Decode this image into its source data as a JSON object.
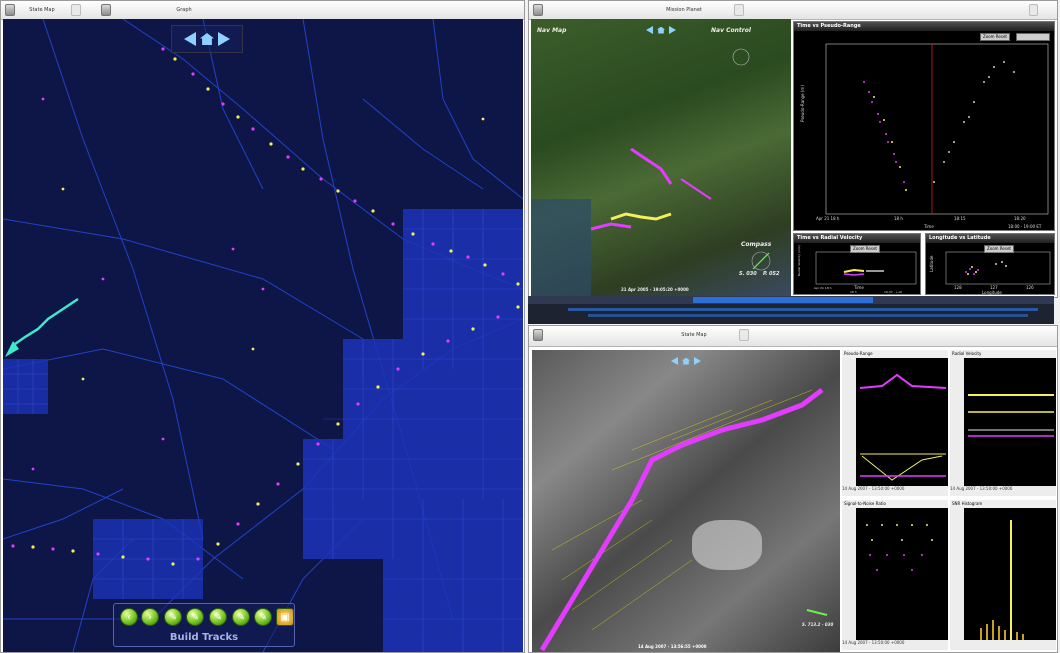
{
  "left_window": {
    "tabs": [
      {
        "label": "State Map"
      },
      {
        "label": "Graph"
      }
    ],
    "toolbar": {
      "label": "Build Tracks",
      "buttons": [
        "back-icon",
        "forward-icon",
        "wrench-icon",
        "pencil-icon",
        "pencil-icon",
        "pencil-icon",
        "pencil-icon",
        "save-icon"
      ]
    },
    "colors": {
      "map_bg": "#0e1648",
      "roads": "#2a4de0",
      "track_magenta": "#e23cff",
      "track_yellow": "#f4ef5a",
      "cyan_track": "#3ee8c8"
    }
  },
  "right_top_window": {
    "tab": "Mission Planet",
    "map_labels": {
      "nav_map": "Nav Map",
      "nav_control": "Nav Control",
      "compass": "Compass"
    },
    "readouts": {
      "timestamp": "21 Apr 2005 - 19:05:20 +0000",
      "left": "S. 030",
      "right": "P. 052"
    },
    "charts": [
      {
        "title": "Time vs Pseudo-Range",
        "zoom_reset": "Zoom Reset",
        "ylabel": "Pseudo-Range (m)",
        "xlabel": "Time",
        "x_ticks": [
          "Apr 21 18 h",
          "18 h",
          "18:15",
          "18:20"
        ],
        "footer": "18:00 - 19:00 ET"
      },
      {
        "title": "Time vs Radial Velocity",
        "zoom_reset": "Zoom Reset",
        "ylabel": "Radial Velocity (m/s)",
        "xlabel": "Time",
        "x_ticks": [
          "Apr 21 18 h",
          "18 h"
        ],
        "footer": "19:37 - +10"
      },
      {
        "title": "Longitude vs Latitude",
        "zoom_reset": "Zoom Reset",
        "ylabel": "Latitude",
        "xlabel": "Longitude",
        "x_ticks": [
          "128",
          "127",
          "126"
        ]
      }
    ]
  },
  "right_bottom_window": {
    "tab": "State Map",
    "timestamp": "14 Aug 2007 - 13:56:55 +0000",
    "readout": "S. 713.2 - 030",
    "panels": [
      {
        "title": "Pseudo-Range",
        "footer": "14 Aug 2007 - 13:50:00 +0000"
      },
      {
        "title": "Radial Velocity",
        "footer": "14 Aug 2007 - 13:50:00 +0000"
      },
      {
        "title": "Signal-to-Noise Ratio",
        "footer": "14 Aug 2007 - 13:50:00 +0000"
      },
      {
        "title": "SNR Histogram",
        "footer": ""
      }
    ]
  }
}
